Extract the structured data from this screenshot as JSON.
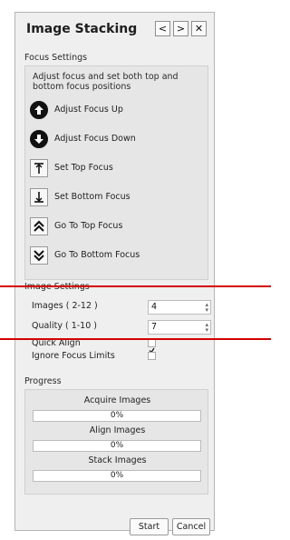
{
  "window": {
    "title": "Image Stacking",
    "nav": {
      "prev": "<",
      "next": ">",
      "close": "✕"
    }
  },
  "focus_settings": {
    "label": "Focus Settings",
    "description": "Adjust focus and set both top and bottom focus positions",
    "buttons": [
      {
        "label": "Adjust Focus Up",
        "icon": "arrow-up-circle-icon"
      },
      {
        "label": "Adjust Focus Down",
        "icon": "arrow-down-circle-icon"
      },
      {
        "label": "Set Top Focus",
        "icon": "set-top-icon"
      },
      {
        "label": "Set Bottom Focus",
        "icon": "set-bottom-icon"
      },
      {
        "label": "Go To Top Focus",
        "icon": "double-chevron-up-icon"
      },
      {
        "label": "Go To Bottom Focus",
        "icon": "double-chevron-down-icon"
      }
    ]
  },
  "image_settings": {
    "label": "Image Settings",
    "images": {
      "label": "Images ( 2-12 )",
      "value": "4"
    },
    "quality": {
      "label": "Quality ( 1-10 )",
      "value": "7"
    },
    "quick_align": {
      "label": "Quick Align",
      "checked": true
    },
    "ignore_limits": {
      "label": "Ignore Focus Limits",
      "checked": false
    }
  },
  "progress": {
    "label": "Progress",
    "items": [
      {
        "label": "Acquire Images",
        "text": "0%",
        "value": 0
      },
      {
        "label": "Align Images",
        "text": "0%",
        "value": 0
      },
      {
        "label": "Stack Images",
        "text": "0%",
        "value": 0
      }
    ]
  },
  "actions": {
    "start": "Start",
    "cancel": "Cancel"
  },
  "annotation_color": "#d40000"
}
